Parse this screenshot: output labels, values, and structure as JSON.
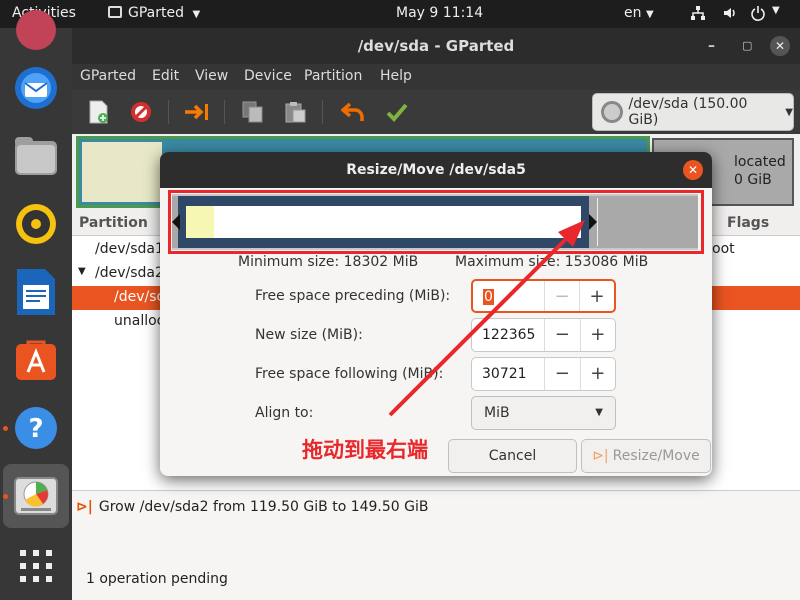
{
  "topbar": {
    "activities": "Activities",
    "app_menu": "GParted",
    "clock": "May 9  11:14",
    "input_source": "en"
  },
  "window": {
    "title": "/dev/sda - GParted"
  },
  "menu": [
    "GParted",
    "Edit",
    "View",
    "Device",
    "Partition",
    "Help"
  ],
  "device_selector": {
    "label": "/dev/sda (150.00 GiB)"
  },
  "graph": {
    "unallocated_label": "located",
    "unallocated_size": "0 GiB"
  },
  "partition_table": {
    "headers": {
      "partition": "Partition",
      "flags": "Flags"
    },
    "rows": [
      {
        "name": "/dev/sda1",
        "flags": "oot"
      },
      {
        "name": "/dev/sda2",
        "flags": ""
      },
      {
        "name": "/dev/sc",
        "flags": ""
      },
      {
        "name": "unalloc",
        "flags": ""
      }
    ]
  },
  "operations": {
    "item": "Grow /dev/sda2 from 119.50 GiB to 149.50 GiB",
    "status": "1 operation pending"
  },
  "dialog": {
    "title": "Resize/Move /dev/sda5",
    "min_size": "Minimum size: 18302 MiB",
    "max_size": "Maximum size: 153086 MiB",
    "free_preceding_label": "Free space preceding (MiB):",
    "free_preceding_value": "0",
    "new_size_label": "New size (MiB):",
    "new_size_value": "122365",
    "free_following_label": "Free space following (MiB):",
    "free_following_value": "30721",
    "align_label": "Align to:",
    "align_value": "MiB",
    "cancel": "Cancel",
    "resize_move": "Resize/Move",
    "minus": "−",
    "plus": "+",
    "used_fraction": 0.15,
    "partition_fraction": 0.8
  },
  "annotation": {
    "text": "拖动到最右端",
    "color": "#e8282b"
  },
  "colors": {
    "accent": "#e95420",
    "selected_row": "#e95420",
    "partition_border": "#2f4868",
    "used": "#f7f7b4"
  }
}
